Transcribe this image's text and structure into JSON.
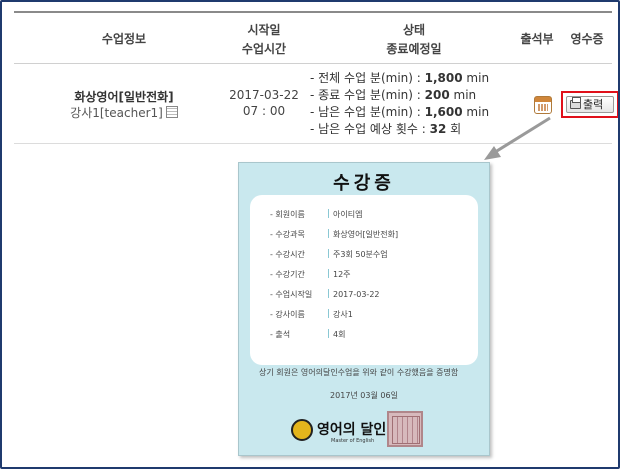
{
  "table": {
    "headers": {
      "info": "수업정보",
      "start_line1": "시작일",
      "start_line2": "수업시간",
      "status_line1": "상태",
      "status_line2": "종료예정일",
      "attendance": "출석부",
      "receipt": "영수증"
    },
    "row": {
      "course": "화상영어[일반전화]",
      "teacher": "강사1[teacher1]",
      "date": "2017-03-22",
      "time": "07 : 00",
      "stats": [
        {
          "label": "- 전체 수업 분(min) : ",
          "value": "1,800",
          "unit": " min"
        },
        {
          "label": "- 종료 수업 분(min) : ",
          "value": "200",
          "unit": " min"
        },
        {
          "label": "- 남은 수업 분(min) : ",
          "value": "1,600",
          "unit": " min"
        },
        {
          "label": "- 남은 수업 예상 횟수 : ",
          "value": "32",
          "unit": " 회"
        }
      ],
      "print_label": "출력"
    }
  },
  "certificate": {
    "title": "수강증",
    "fields": [
      {
        "label": "- 회원이름",
        "value": "아이티엡"
      },
      {
        "label": "- 수강과목",
        "value": "화상영어[일반전화]"
      },
      {
        "label": "- 수강시간",
        "value": "주3회 50분수업"
      },
      {
        "label": "- 수강기간",
        "value": "12주"
      },
      {
        "label": "- 수업시작일",
        "value": "2017-03-22"
      },
      {
        "label": "- 강사이름",
        "value": "강사1"
      },
      {
        "label": "- 출석",
        "value": "4회"
      }
    ],
    "note": "상기 회원은 영어의달인수업을 위와 같이 수강했음을 증명함",
    "date": "2017년 03월 06일",
    "logo_text": "영어의 달인",
    "logo_sub": "Master of English",
    "seal_text": "영어의달인직인"
  },
  "colors": {
    "frame": "#1f3a6e",
    "highlight": "#e0101a",
    "cert_bg": "#c9e8ee"
  }
}
